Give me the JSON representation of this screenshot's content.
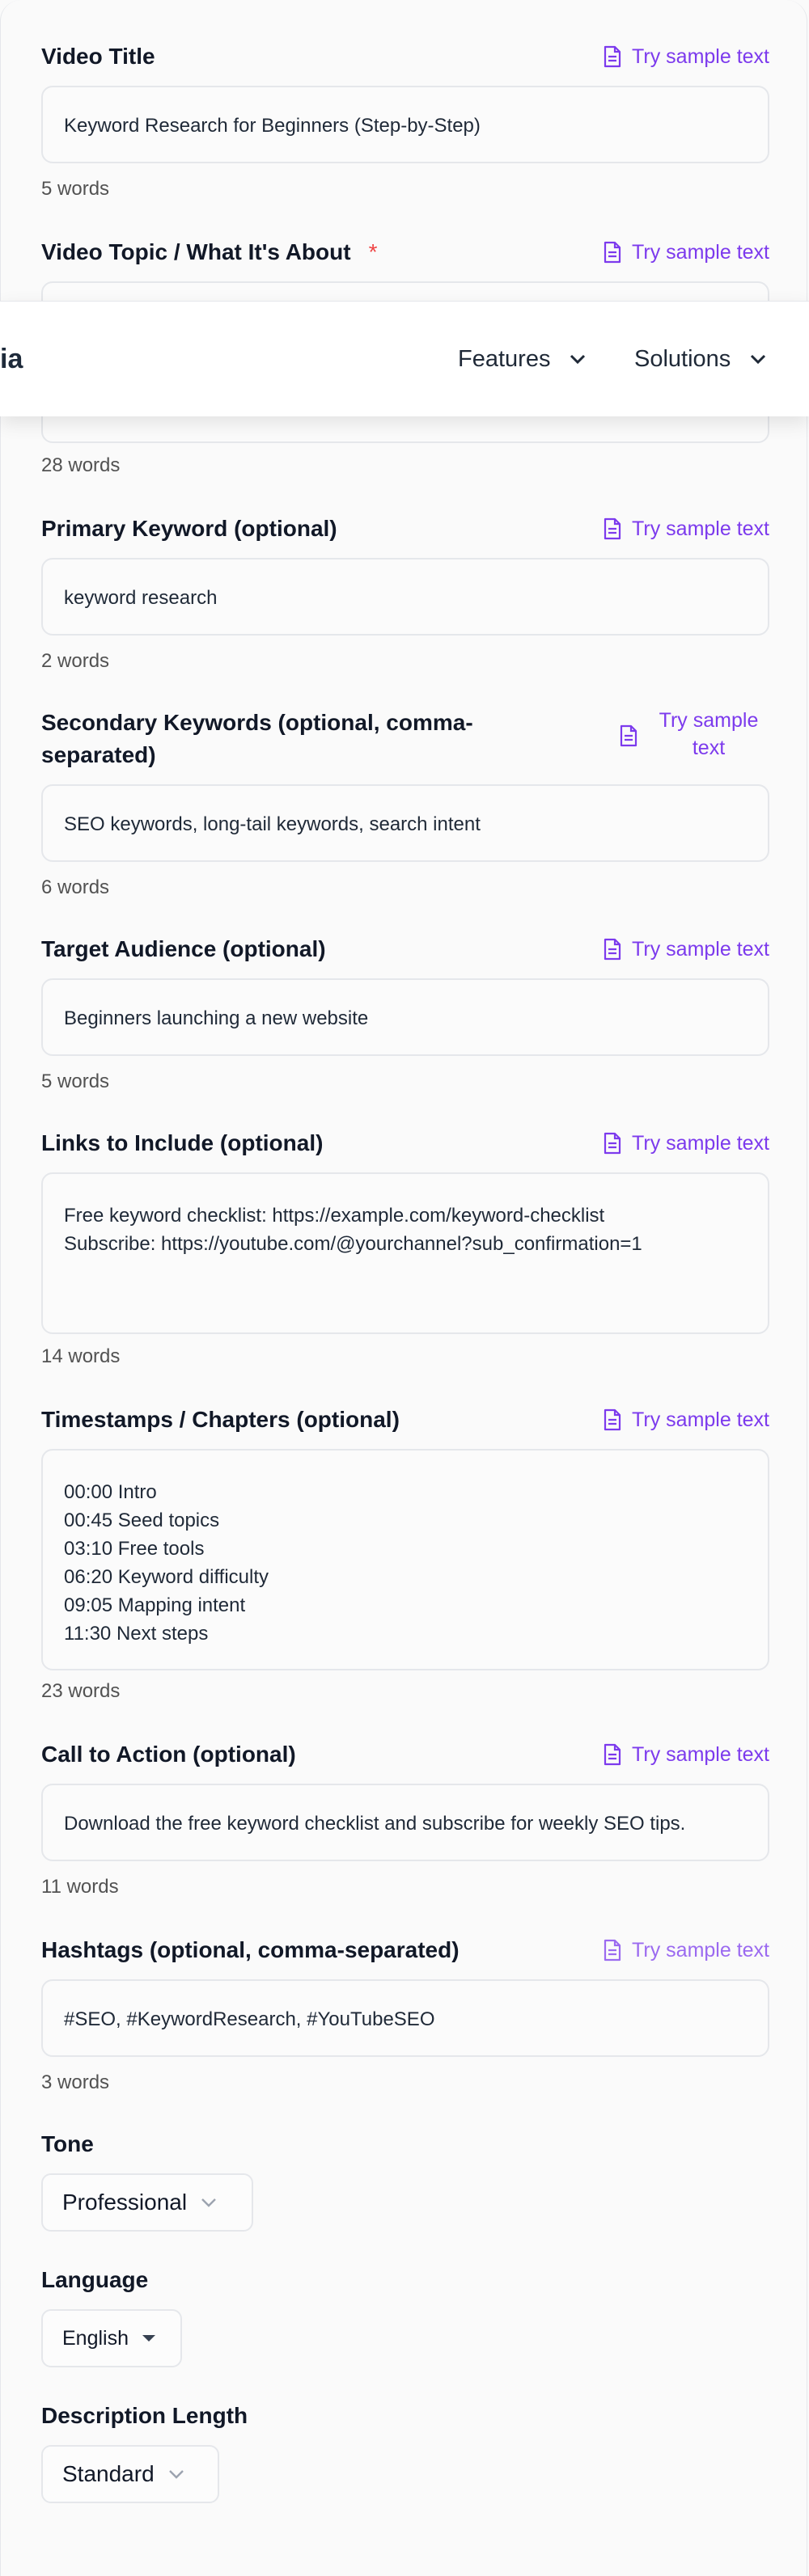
{
  "sample_label": "Try sample text",
  "fields": {
    "video_title": {
      "label": "Video Title",
      "value": "Keyword Research for Beginners (Step-by-Step)",
      "count": "5 words"
    },
    "video_topic": {
      "label": "Video Topic / What It's About",
      "required_mark": "*",
      "count": "28 words"
    },
    "primary_keyword": {
      "label": "Primary Keyword (optional)",
      "value": "keyword research",
      "count": "2 words"
    },
    "secondary_keywords": {
      "label": "Secondary Keywords (optional, comma-separated)",
      "value": "SEO keywords, long-tail keywords, search intent",
      "count": "6 words"
    },
    "target_audience": {
      "label": "Target Audience (optional)",
      "value": "Beginners launching a new website",
      "count": "5 words"
    },
    "links": {
      "label": "Links to Include (optional)",
      "value": "Free keyword checklist: https://example.com/keyword-checklist\nSubscribe: https://youtube.com/@yourchannel?sub_confirmation=1",
      "count": "14 words"
    },
    "timestamps": {
      "label": "Timestamps / Chapters (optional)",
      "value": "00:00 Intro\n00:45 Seed topics\n03:10 Free tools\n06:20 Keyword difficulty\n09:05 Mapping intent\n11:30 Next steps",
      "count": "23 words"
    },
    "cta": {
      "label": "Call to Action (optional)",
      "value": "Download the free keyword checklist and subscribe for weekly SEO tips.",
      "count": "11 words"
    },
    "hashtags": {
      "label": "Hashtags (optional, comma-separated)",
      "value": "#SEO, #KeywordResearch, #YouTubeSEO",
      "count": "3 words"
    }
  },
  "tone": {
    "label": "Tone",
    "value": "Professional"
  },
  "language": {
    "label": "Language",
    "value": "English"
  },
  "description_length": {
    "label": "Description Length",
    "value": "Standard"
  },
  "navbar": {
    "logo_fragment": "ia",
    "features": "Features",
    "solutions": "Solutions"
  },
  "colors": {
    "accent": "#7c3aed",
    "required": "#ef4444"
  },
  "icons": {
    "sample": "document-icon",
    "dropdown": "chevron-down-icon",
    "language": "caret-down-icon"
  }
}
